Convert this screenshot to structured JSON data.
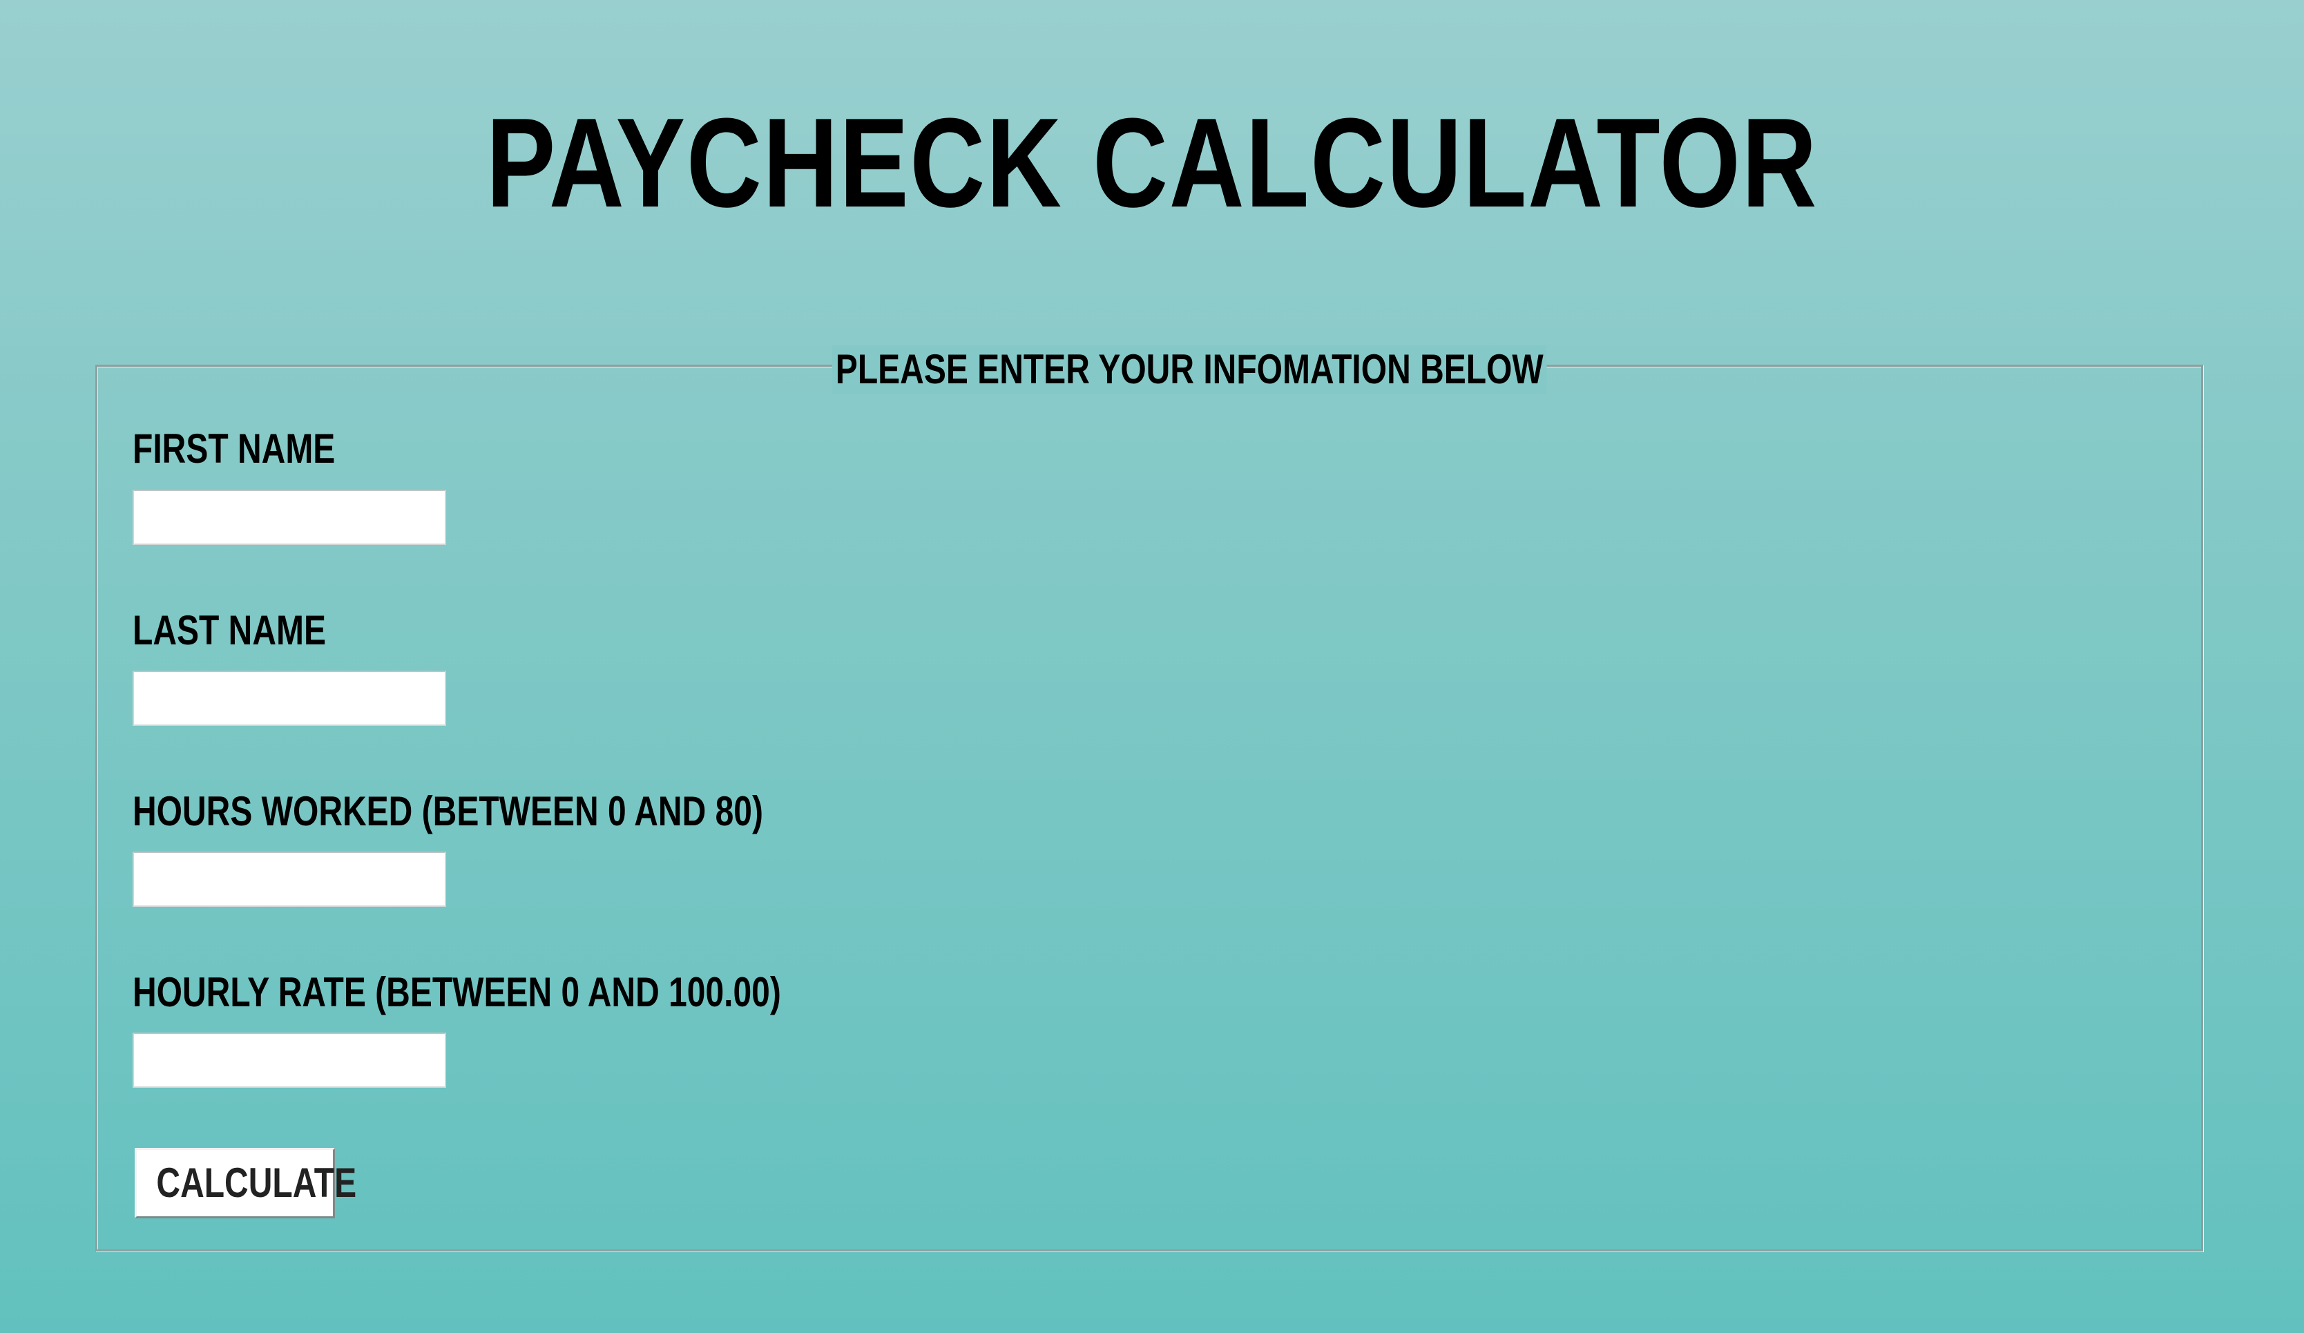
{
  "page": {
    "title": "PAYCHECK CALCULATOR"
  },
  "form": {
    "legend": "PLEASE ENTER YOUR INFOMATION BELOW",
    "fields": [
      {
        "label": "FIRST NAME",
        "value": "",
        "placeholder": ""
      },
      {
        "label": "LAST NAME",
        "value": "",
        "placeholder": ""
      },
      {
        "label": "HOURS WORKED (BETWEEN 0 AND 80)",
        "value": "",
        "placeholder": ""
      },
      {
        "label": "HOURLY RATE (BETWEEN 0 AND 100.00)",
        "value": "",
        "placeholder": ""
      }
    ],
    "submit_label": "CALCULATE"
  },
  "colors": {
    "background_top": "#99cfcf",
    "background_bottom": "#62c1be",
    "text": "#000000",
    "input_background": "#ffffff",
    "fieldset_border": "#8f9e9e"
  }
}
